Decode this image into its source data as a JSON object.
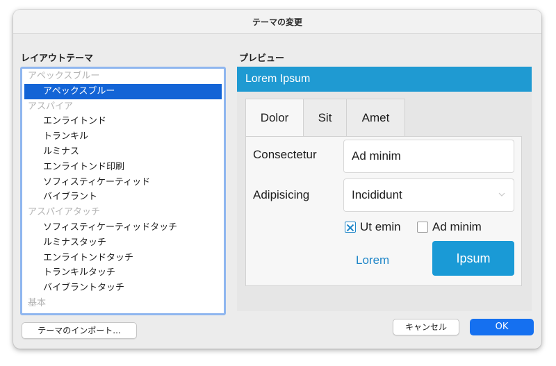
{
  "window": {
    "title": "テーマの変更"
  },
  "layout_theme": {
    "label": "レイアウトテーマ",
    "items": [
      {
        "label": "アペックスブルー",
        "kind": "group"
      },
      {
        "label": "アペックスブルー",
        "kind": "item",
        "selected": true
      },
      {
        "label": "アスパイア",
        "kind": "group"
      },
      {
        "label": "エンライトンド",
        "kind": "item"
      },
      {
        "label": "トランキル",
        "kind": "item"
      },
      {
        "label": "ルミナス",
        "kind": "item"
      },
      {
        "label": "エンライトンド印刷",
        "kind": "item"
      },
      {
        "label": "ソフィスティケーティッド",
        "kind": "item"
      },
      {
        "label": "バイブラント",
        "kind": "item"
      },
      {
        "label": "アスパイアタッチ",
        "kind": "group"
      },
      {
        "label": "ソフィスティケーティッドタッチ",
        "kind": "item"
      },
      {
        "label": "ルミナスタッチ",
        "kind": "item"
      },
      {
        "label": "エンライトンドタッチ",
        "kind": "item"
      },
      {
        "label": "トランキルタッチ",
        "kind": "item"
      },
      {
        "label": "バイブラントタッチ",
        "kind": "item"
      },
      {
        "label": "基本",
        "kind": "group"
      }
    ],
    "import_button": "テーマのインポート..."
  },
  "preview": {
    "label": "プレビュー",
    "header": "Lorem Ipsum",
    "tabs": [
      "Dolor",
      "Sit",
      "Amet"
    ],
    "field1_label": "Consectetur",
    "field1_value": "Ad minim",
    "field2_label": "Adipisicing",
    "field2_value": "Incididunt",
    "checkbox1": {
      "label": "Ut emin",
      "checked": true
    },
    "checkbox2": {
      "label": "Ad minim",
      "checked": false
    },
    "secondary_button": "Lorem",
    "primary_button": "Ipsum",
    "header_color": "#1f9ad2",
    "accent_color": "#1a9ad6"
  },
  "footer": {
    "cancel": "キャンセル",
    "ok": "OK",
    "ok_color": "#1570f0"
  }
}
